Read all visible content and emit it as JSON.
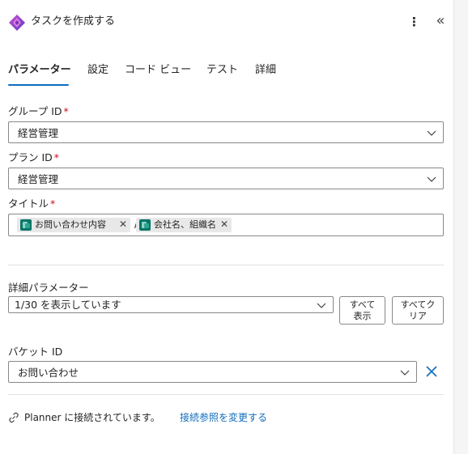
{
  "header": {
    "title": "タスクを作成する",
    "icon": "power-automate-logo",
    "more_icon": "more-vertical-icon",
    "collapse_icon": "double-chevron-left-icon"
  },
  "tabs": [
    {
      "label": "パラメーター",
      "active": true
    },
    {
      "label": "設定",
      "active": false
    },
    {
      "label": "コード ビュー",
      "active": false
    },
    {
      "label": "テスト",
      "active": false
    },
    {
      "label": "詳細",
      "active": false
    }
  ],
  "fields": {
    "group": {
      "label": "グループ ID",
      "required_mark": "*",
      "value": "経営管理"
    },
    "plan": {
      "label": "プラン ID",
      "required_mark": "*",
      "value": "経営管理"
    },
    "title": {
      "label": "タイトル",
      "required_mark": "*",
      "tokens": [
        {
          "label": "お問い合わせ内容",
          "icon": "forms-token-icon"
        },
        {
          "label": "会社名、組織名",
          "icon": "forms-token-icon"
        }
      ],
      "separator": "/"
    }
  },
  "advanced": {
    "label": "詳細パラメーター",
    "dropdown_value": "1/30 を表示しています",
    "show_all_label": [
      "すべて",
      "表示"
    ],
    "clear_all_label": [
      "すべてク",
      "リア"
    ]
  },
  "bucket": {
    "label": "バケット ID",
    "value": "お問い合わせ"
  },
  "connection": {
    "status_text": "Planner に接続されています。",
    "change_link": "接続参照を変更する"
  },
  "colors": {
    "accent": "#0f6cbd",
    "required": "#c50f1f",
    "token_bg": "#e8e8e8"
  }
}
